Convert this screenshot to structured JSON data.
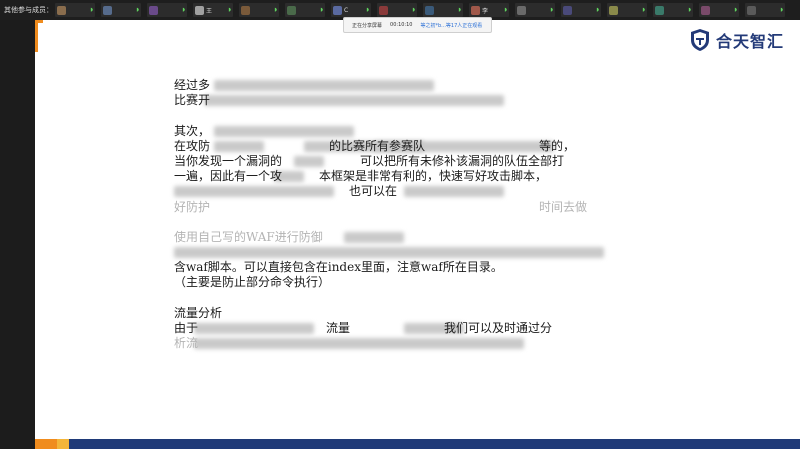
{
  "participants_bar": {
    "label": "其他参与成员：",
    "members": [
      {
        "name": "",
        "color": "#8a6d4d"
      },
      {
        "name": "",
        "color": "#566b8c"
      },
      {
        "name": "",
        "color": "#6a4a8a"
      },
      {
        "name": "王",
        "color": "#a0a0a0"
      },
      {
        "name": "",
        "color": "#7a5a3a"
      },
      {
        "name": "",
        "color": "#4a6a4a"
      },
      {
        "name": "C",
        "color": "#5a6aa0"
      },
      {
        "name": "",
        "color": "#8a3a3a"
      },
      {
        "name": "",
        "color": "#3a5a7a"
      },
      {
        "name": "李",
        "color": "#a0584a"
      },
      {
        "name": "",
        "color": "#6a6a6a"
      },
      {
        "name": "",
        "color": "#4a4a7a"
      },
      {
        "name": "",
        "color": "#8a8a4a"
      },
      {
        "name": "",
        "color": "#3a7a6a"
      },
      {
        "name": "",
        "color": "#7a4a6a"
      },
      {
        "name": "",
        "color": "#5a5a5a"
      }
    ]
  },
  "share_status": {
    "label": "正在分享屏幕",
    "time": "00:10:10",
    "viewers": "等之初*b...等17人正在观看"
  },
  "slide": {
    "logo_text": "合天智汇",
    "brand_color": "#233a78",
    "accent_color": "#f08c1e",
    "lines": [
      "经过多",
      "比赛开",
      "",
      "其次，",
      "在攻防",
      "当你发现一个漏洞的",
      "一遍，因此有一个攻",
      "",
      "好防护",
      "",
      "使用自己写的WAF进行防御",
      "",
      "含waf脚本。可以直接包含在index里面，注意waf所在目录。",
      "（主要是防止部分命令执行）",
      "",
      "流量分析",
      "由于",
      "析流"
    ],
    "line_tails": [
      "",
      "",
      "",
      "",
      "的比赛所有参赛队",
      "可以把所有未修补该漏洞的队伍全部打",
      "本框架是非常有利的，快速写好攻击脚本，",
      "也可以在",
      "时间去做",
      "",
      "",
      "",
      "",
      "",
      "",
      "",
      "流量",
      ""
    ],
    "line_tails2": [
      "",
      "",
      "",
      "",
      "等的，",
      "",
      "",
      "",
      "",
      "",
      "",
      "",
      "",
      "",
      "",
      "",
      "我们可以及时通过分",
      ""
    ]
  },
  "bottom_bar": {
    "navy": "#1f3a78",
    "orange": "#f08c1e"
  }
}
